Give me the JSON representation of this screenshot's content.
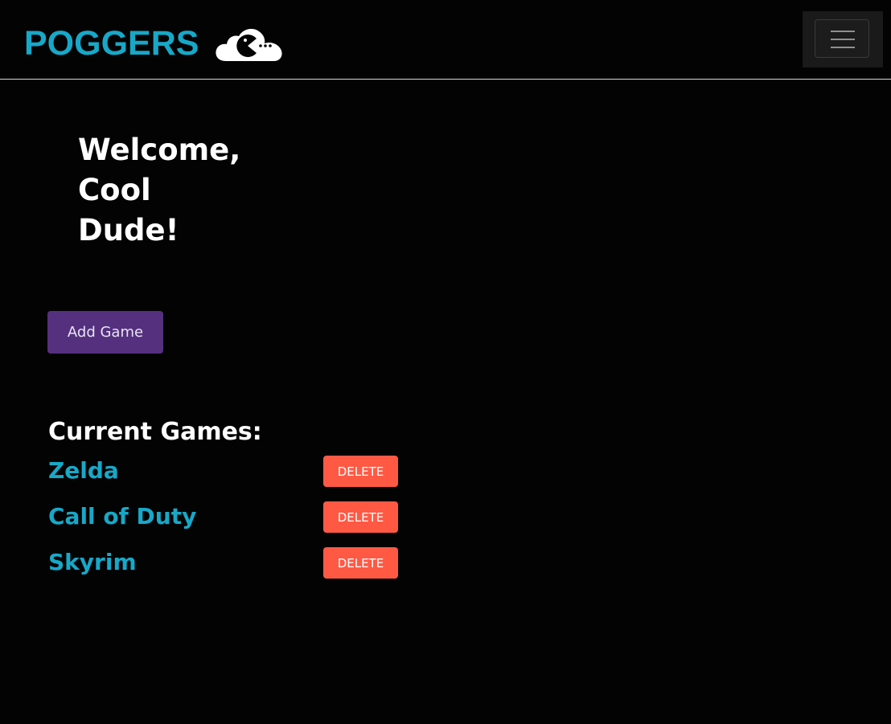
{
  "navbar": {
    "brand": "POGGERS",
    "logo_icon": "pacman-cloud-icon",
    "menu_icon": "hamburger-menu-icon",
    "colors": {
      "brand": "#17a8c8",
      "background": "#030303"
    }
  },
  "main": {
    "welcome": "Welcome, Cool Dude!",
    "add_game_label": "Add Game",
    "current_games_title": "Current Games:",
    "games": [
      {
        "name": "Zelda",
        "delete_label": "DELETE"
      },
      {
        "name": "Call of Duty",
        "delete_label": "DELETE"
      },
      {
        "name": "Skyrim",
        "delete_label": "DELETE"
      }
    ],
    "colors": {
      "add_button": "#55307f",
      "delete_button": "#ff5944",
      "game_link": "#17a8c8"
    }
  }
}
